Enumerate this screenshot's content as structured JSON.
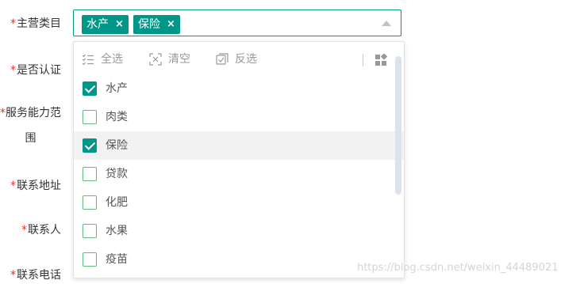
{
  "form": {
    "required_mark": "*",
    "labels": {
      "category": "主营类目",
      "certified": "是否认证",
      "service_line1": "服务能力范",
      "service_line2": "围",
      "address": "联系地址",
      "contact": "联系人",
      "phone": "联系电话"
    }
  },
  "select": {
    "tags": [
      "水产",
      "保险"
    ],
    "tag_close": "×"
  },
  "dropdown": {
    "toolbar": {
      "select_all": "全选",
      "clear": "清空",
      "invert": "反选"
    },
    "options": [
      {
        "label": "水产",
        "checked": true
      },
      {
        "label": "肉类",
        "checked": false
      },
      {
        "label": "保险",
        "checked": true
      },
      {
        "label": "贷款",
        "checked": false
      },
      {
        "label": "化肥",
        "checked": false
      },
      {
        "label": "水果",
        "checked": false
      },
      {
        "label": "疫苗",
        "checked": false
      }
    ]
  },
  "watermark": "https://blog.csdn.net/weixin_44489021",
  "colors": {
    "accent": "#009688",
    "required": "#e0322b",
    "checkbox_border": "#5FB878"
  }
}
